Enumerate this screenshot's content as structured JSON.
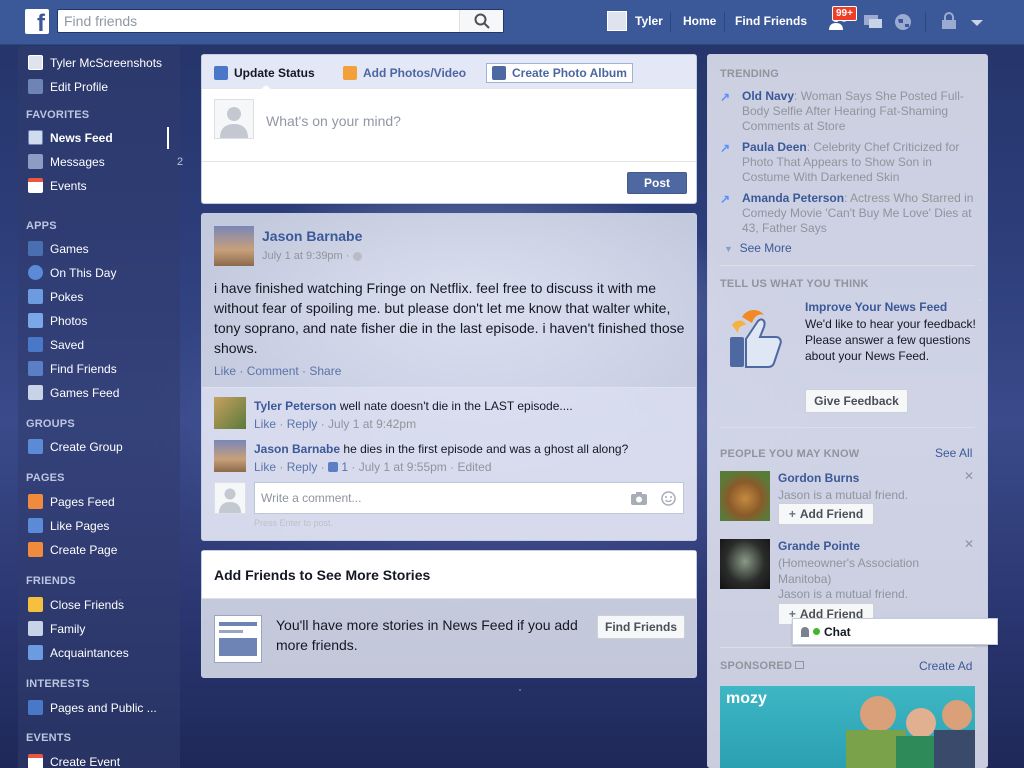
{
  "topbar": {
    "logo": "f",
    "search_placeholder": "Find friends",
    "user_name": "Tyler",
    "home": "Home",
    "find_friends": "Find Friends",
    "notif_badge": "99+"
  },
  "sidebar": {
    "profile_name": "Tyler McScreenshots",
    "edit_profile": "Edit Profile",
    "favorites_header": "FAVORITES",
    "news_feed": "News Feed",
    "messages": "Messages",
    "messages_count": "2",
    "events": "Events",
    "apps_header": "APPS",
    "apps": [
      "Games",
      "On This Day",
      "Pokes",
      "Photos",
      "Saved",
      "Find Friends",
      "Games Feed"
    ],
    "groups_header": "GROUPS",
    "create_group": "Create Group",
    "pages_header": "PAGES",
    "pages": [
      "Pages Feed",
      "Like Pages",
      "Create Page"
    ],
    "friends_header": "FRIENDS",
    "friends": [
      "Close Friends",
      "Family",
      "Acquaintances"
    ],
    "interests_header": "INTERESTS",
    "interests_item": "Pages and Public ...",
    "events_header": "EVENTS",
    "create_event": "Create Event"
  },
  "composer": {
    "tab_update": "Update Status",
    "tab_photos": "Add Photos/Video",
    "tab_album": "Create Photo Album",
    "placeholder": "What's on your mind?",
    "post": "Post"
  },
  "story": {
    "author": "Jason Barnabe",
    "time": "July 1 at 9:39pm ·",
    "text": "i have finished watching Fringe on Netflix. feel free to discuss it with me without fear of spoiling me. but please don't let me know that walter white, tony soprano, and nate fisher die in the last episode. i haven't finished those shows.",
    "actions": [
      "Like",
      "Comment",
      "Share"
    ],
    "comments": [
      {
        "name": "Tyler Peterson",
        "text": "well nate doesn't die in the LAST episode....",
        "like": "Like",
        "reply": "Reply",
        "time": "July 1 at 9:42pm"
      },
      {
        "name": "Jason Barnabe",
        "text": "he dies in the first episode and was a ghost all along?",
        "like": "Like",
        "reply": "Reply",
        "likes": "1",
        "time": "July 1 at 9:55pm · Edited"
      }
    ],
    "write_placeholder": "Write a comment...",
    "press_enter": "Press Enter to post."
  },
  "add_friends": {
    "title": "Add Friends to See More Stories",
    "text": "You'll have more stories in News Feed if you add more friends.",
    "button": "Find Friends"
  },
  "right": {
    "trending_header": "TRENDING",
    "trends": [
      {
        "name": "Old Navy",
        "text": ": Woman Says She Posted Full-Body Selfie After Hearing Fat-Shaming Comments at Store"
      },
      {
        "name": "Paula Deen",
        "text": ": Celebrity Chef Criticized for Photo That Appears to Show Son in Costume With Darkened Skin"
      },
      {
        "name": "Amanda Peterson",
        "text": ": Actress Who Starred in Comedy Movie 'Can't Buy Me Love' Dies at 43, Father Says"
      }
    ],
    "see_more": "See More",
    "feedback_header": "TELL US WHAT YOU THINK",
    "feedback_title": "Improve Your News Feed",
    "feedback_text": "We'd like to hear your feedback! Please answer a few questions about your News Feed.",
    "feedback_button": "Give Feedback",
    "pymk_header": "PEOPLE YOU MAY KNOW",
    "see_all": "See All",
    "people": [
      {
        "name": "Gordon Burns",
        "sub": "Jason is a mutual friend.",
        "button": "Add Friend"
      },
      {
        "name": "Grande Pointe",
        "sub": "(Homeowner's Association Manitoba)",
        "sub2": "Jason is a mutual friend.",
        "button": "Add Friend"
      }
    ],
    "sponsored_header": "SPONSORED",
    "create_ad": "Create Ad",
    "ad_brand": "mozy"
  },
  "chat": {
    "label": "Chat"
  },
  "colors": {
    "brand": "#3b5998",
    "link": "#3b5998",
    "badge": "#f03d25"
  }
}
